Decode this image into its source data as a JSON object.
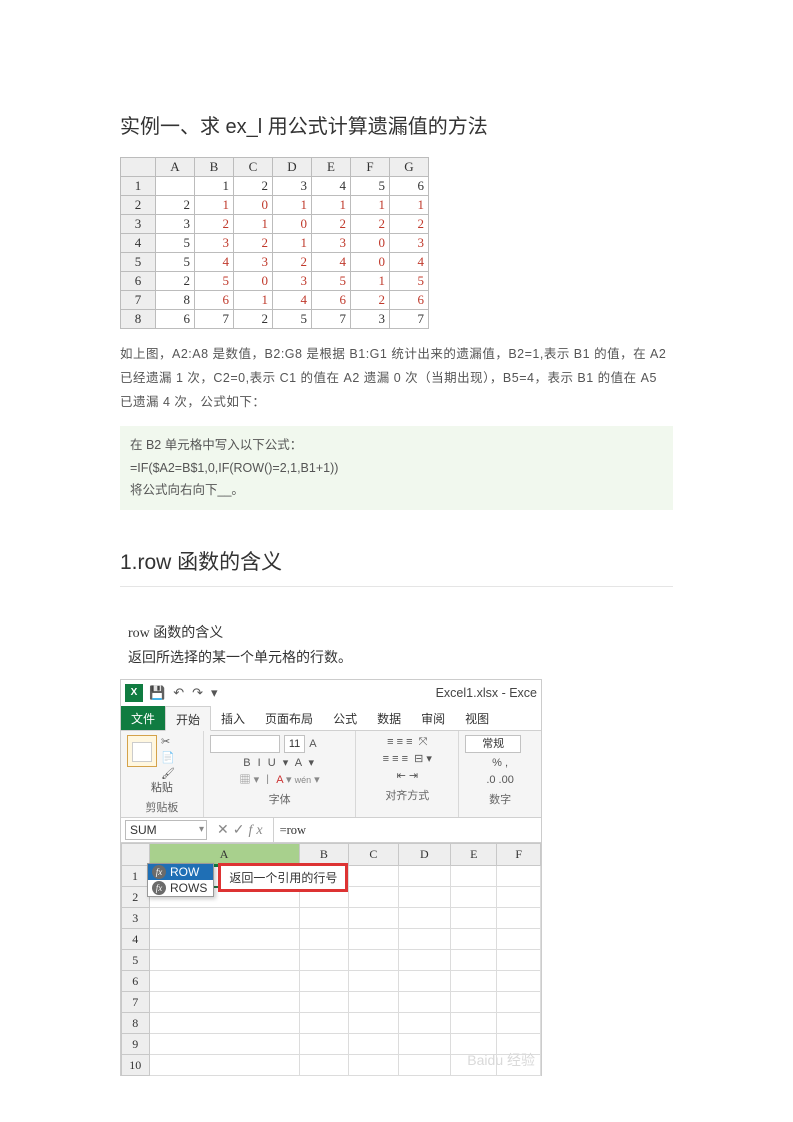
{
  "heading1": "实例一、求 ex_l 用公式计算遗漏值的方法",
  "table1": {
    "cols": [
      "A",
      "B",
      "C",
      "D",
      "E",
      "F",
      "G"
    ],
    "rows": [
      {
        "n": "1",
        "A": "",
        "cells": [
          "1",
          "2",
          "3",
          "4",
          "5",
          "6"
        ],
        "red": [
          false,
          false,
          false,
          false,
          false,
          false
        ]
      },
      {
        "n": "2",
        "A": "2",
        "cells": [
          "1",
          "0",
          "1",
          "1",
          "1",
          "1"
        ],
        "red": [
          true,
          true,
          true,
          true,
          true,
          true
        ]
      },
      {
        "n": "3",
        "A": "3",
        "cells": [
          "2",
          "1",
          "0",
          "2",
          "2",
          "2"
        ],
        "red": [
          true,
          true,
          true,
          true,
          true,
          true
        ]
      },
      {
        "n": "4",
        "A": "5",
        "cells": [
          "3",
          "2",
          "1",
          "3",
          "0",
          "3"
        ],
        "red": [
          true,
          true,
          true,
          true,
          true,
          true
        ]
      },
      {
        "n": "5",
        "A": "5",
        "cells": [
          "4",
          "3",
          "2",
          "4",
          "0",
          "4"
        ],
        "red": [
          true,
          true,
          true,
          true,
          true,
          true
        ]
      },
      {
        "n": "6",
        "A": "2",
        "cells": [
          "5",
          "0",
          "3",
          "5",
          "1",
          "5"
        ],
        "red": [
          true,
          true,
          true,
          true,
          true,
          true
        ]
      },
      {
        "n": "7",
        "A": "8",
        "cells": [
          "6",
          "1",
          "4",
          "6",
          "2",
          "6"
        ],
        "red": [
          true,
          true,
          true,
          true,
          true,
          true
        ]
      },
      {
        "n": "8",
        "A": "6",
        "cells": [
          "7",
          "2",
          "5",
          "7",
          "3",
          "7"
        ],
        "red": [
          false,
          false,
          false,
          false,
          false,
          false
        ]
      }
    ]
  },
  "para1": "如上图，A2:A8 是数值，B2:G8 是根据 B1:G1 统计出来的遗漏值，B2=1,表示 B1 的值，在 A2 已经遗漏 1 次，C2=0,表示 C1 的值在 A2 遗漏 0 次（当期出现），B5=4，表示 B1 的值在 A5 已遗漏 4 次，公式如下：",
  "code": {
    "l1": "在 B2 单元格中写入以下公式：",
    "l2": "=IF($A2=B$1,0,IF(ROW()=2,1,B1+1))",
    "l3": "将公式向右向下__。"
  },
  "heading2": "1.row 函数的含义",
  "desc": {
    "l1": "row 函数的含义",
    "l2": "返回所选择的某一个单元格的行数。"
  },
  "excel": {
    "title": "Excel1.xlsx - Exce",
    "tabs": {
      "file": "文件",
      "start": "开始",
      "insert": "插入",
      "layout": "页面布局",
      "formula": "公式",
      "data": "数据",
      "review": "审阅",
      "view": "视图"
    },
    "groups": {
      "clipboard": "剪贴板",
      "paste": "粘贴",
      "font": "字体",
      "align": "对齐方式",
      "number": "数字"
    },
    "font": {
      "size": "11",
      "btns": "B  I  U ▾   A ▾"
    },
    "numfmt": "常规",
    "namebox": "SUM",
    "fxinput": "=row",
    "cellA1": "=row",
    "suggest": {
      "row": "ROW",
      "rows": "ROWS",
      "tip": "返回一个引用的行号"
    },
    "cols": [
      "A",
      "B",
      "C",
      "D",
      "E",
      "F"
    ],
    "rowcount": 10,
    "watermark": "Baidu 经验"
  }
}
